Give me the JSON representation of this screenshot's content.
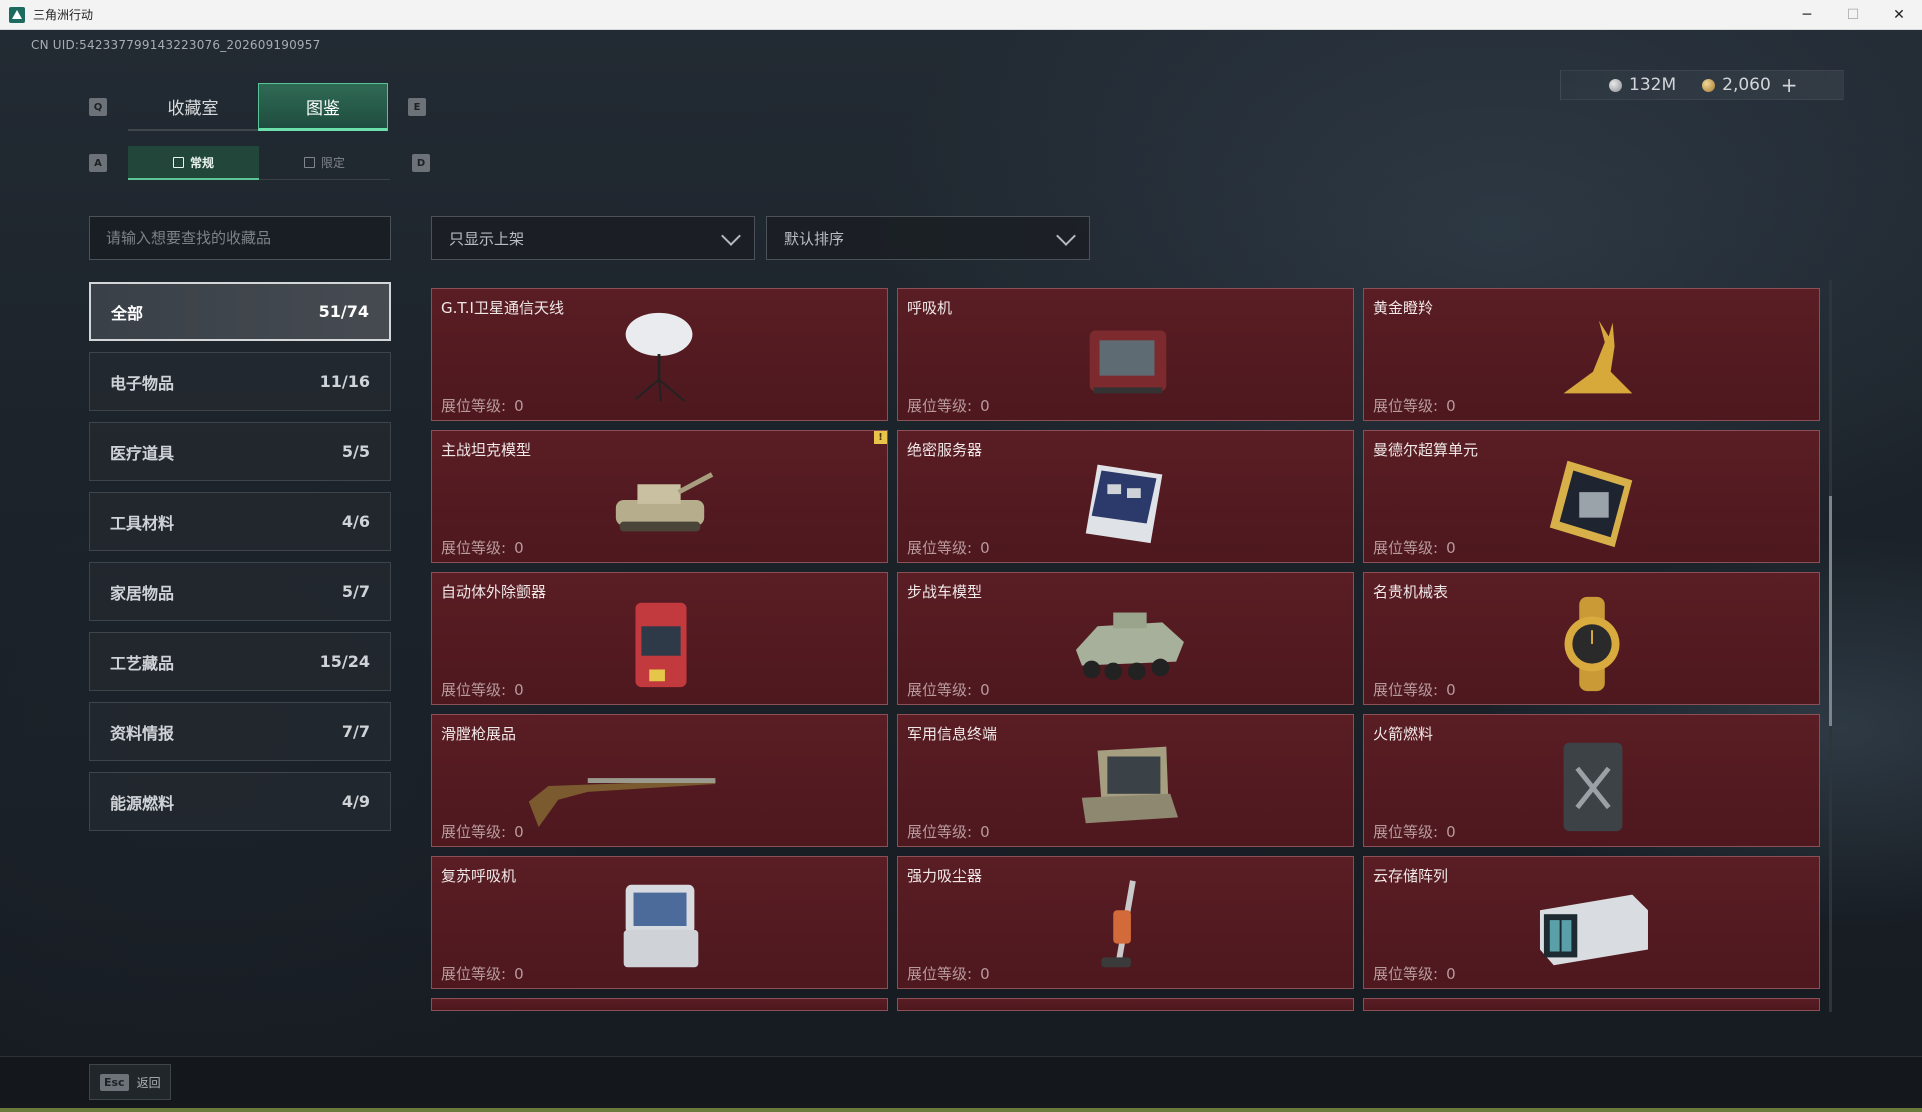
{
  "window": {
    "title": "三角洲行动",
    "controls": {
      "minimize": "─",
      "maximize": "☐",
      "close": "✕"
    }
  },
  "uid": "CN UID:5423377991432230​76_202609190957",
  "currency": {
    "silver": "132M",
    "gold": "2,060",
    "plus": "+"
  },
  "keys": {
    "prev_tab": "Q",
    "next_tab": "E",
    "prev_sub": "A",
    "next_sub": "D",
    "esc": "Esc"
  },
  "tabs": {
    "main": [
      {
        "label": "收藏室"
      },
      {
        "label": "图鉴"
      }
    ],
    "sub": [
      {
        "label": "常规"
      },
      {
        "label": "限定"
      }
    ]
  },
  "search": {
    "placeholder": "请输入想要查找的收藏品"
  },
  "filter": {
    "label": "只显示上架"
  },
  "sort": {
    "label": "默认排序"
  },
  "categories": [
    {
      "name": "全部",
      "count": "51/74"
    },
    {
      "name": "电子物品",
      "count": "11/16"
    },
    {
      "name": "医疗道具",
      "count": "5/5"
    },
    {
      "name": "工具材料",
      "count": "4/6"
    },
    {
      "name": "家居物品",
      "count": "5/7"
    },
    {
      "name": "工艺藏品",
      "count": "15/24"
    },
    {
      "name": "资料情报",
      "count": "7/7"
    },
    {
      "name": "能源燃料",
      "count": "4/9"
    }
  ],
  "level_label": "展位等级:",
  "items": [
    {
      "name": "G.T.I卫星通信天线",
      "level": "0",
      "icon": "satellite-dish-icon"
    },
    {
      "name": "呼吸机",
      "level": "0",
      "icon": "ventilator-icon"
    },
    {
      "name": "黄金瞪羚",
      "level": "0",
      "icon": "golden-gazelle-icon"
    },
    {
      "name": "主战坦克模型",
      "level": "0",
      "icon": "tank-model-icon"
    },
    {
      "name": "绝密服务器",
      "level": "0",
      "icon": "server-icon"
    },
    {
      "name": "曼德尔超算单元",
      "level": "0",
      "icon": "supercomputer-unit-icon"
    },
    {
      "name": "自动体外除颤器",
      "level": "0",
      "icon": "defibrillator-icon"
    },
    {
      "name": "步战车模型",
      "level": "0",
      "icon": "ifv-model-icon"
    },
    {
      "name": "名贵机械表",
      "level": "0",
      "icon": "luxury-watch-icon"
    },
    {
      "name": "滑膛枪展品",
      "level": "0",
      "icon": "musket-icon"
    },
    {
      "name": "军用信息终端",
      "level": "0",
      "icon": "military-terminal-icon"
    },
    {
      "name": "火箭燃料",
      "level": "0",
      "icon": "rocket-fuel-can-icon"
    },
    {
      "name": "复苏呼吸机",
      "level": "0",
      "icon": "resuscitator-icon"
    },
    {
      "name": "强力吸尘器",
      "level": "0",
      "icon": "vacuum-cleaner-icon"
    },
    {
      "name": "云存储阵列",
      "level": "0",
      "icon": "cloud-storage-array-icon"
    }
  ],
  "back": {
    "label": "返回"
  },
  "colors": {
    "accent": "#58c495",
    "card_bg": "#5a1d24",
    "card_border": "#8a5056",
    "warning": "#e8c44a"
  }
}
